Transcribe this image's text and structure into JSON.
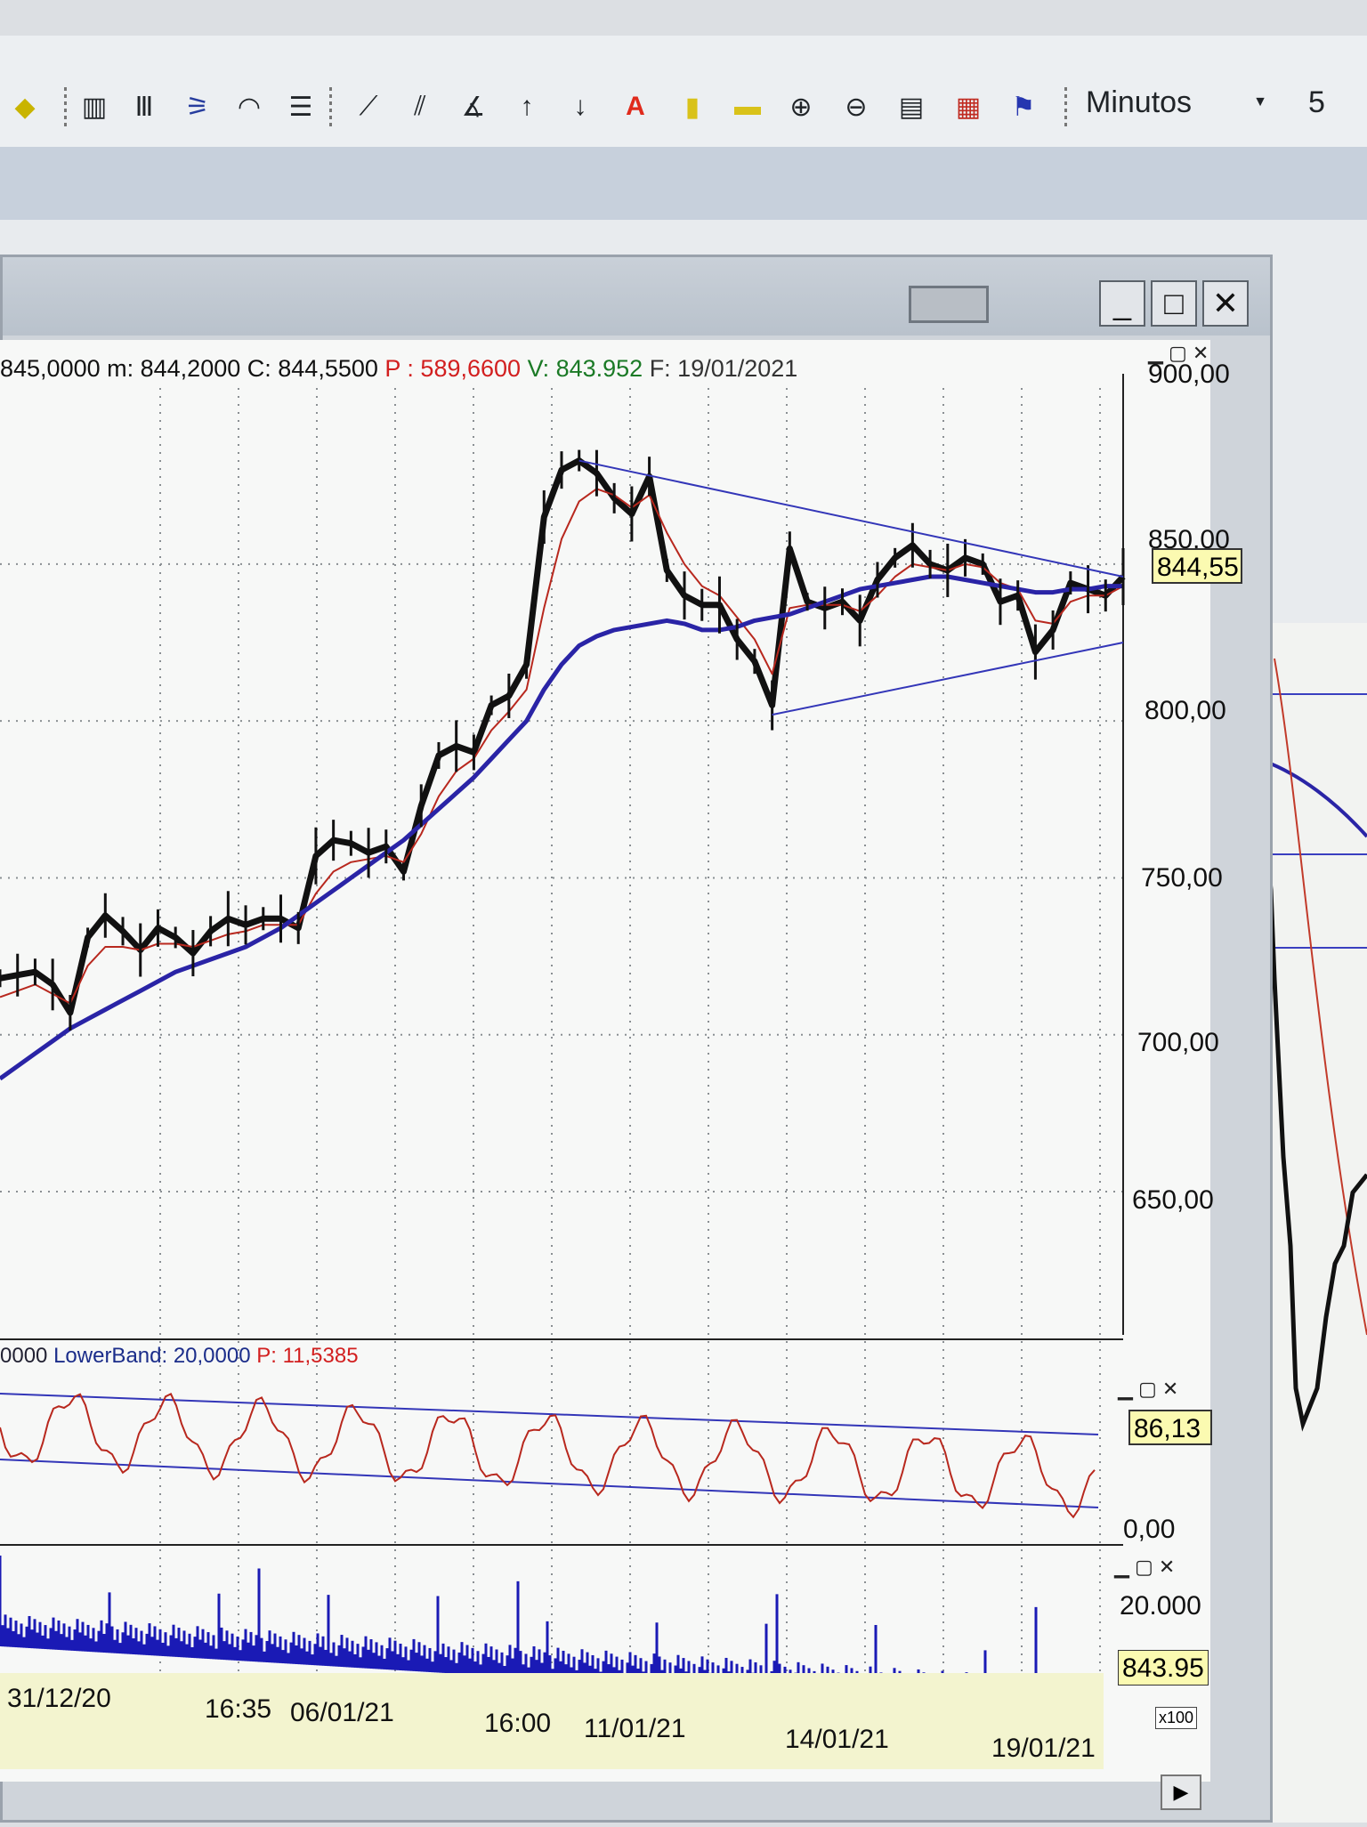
{
  "toolbar": {
    "interval_select": "Minutos",
    "interval_value": "5",
    "icons": [
      "diamond-icon",
      "vertical-line-icon",
      "vertical-lines-icon",
      "fan-icon",
      "arc-icon",
      "horizontal-lines-icon",
      "trendline-icon",
      "parallel-lines-icon",
      "angle-icon",
      "arrow-up-icon",
      "arrow-down-icon",
      "text-icon",
      "highlight-vertical-icon",
      "highlight-horizontal-icon",
      "zoom-in-icon",
      "zoom-out-icon",
      "properties-icon",
      "chart-settings-icon",
      "color-flag-icon"
    ]
  },
  "window": {
    "minimize_glyph": "_",
    "maximize_glyph": "□",
    "close_glyph": "✕"
  },
  "info": {
    "prefix": "845,0000",
    "min": "m: 844,2000",
    "close": "C: 844,5500",
    "p": "P : 589,6600",
    "volume": "V: 843.952",
    "date": "F: 19/01/2021"
  },
  "price_axis": {
    "labels": [
      "900,00",
      "850,00",
      "800,00",
      "750,00",
      "700,00",
      "650,00"
    ],
    "current_price": "844,55"
  },
  "oscillator": {
    "prefix": "0000",
    "lowerband": "LowerBand: 20,0000",
    "p": "P: 11,5385",
    "current": "86,13",
    "zero_label": "0,00"
  },
  "volume_pane": {
    "top_label": "20.000",
    "current": "843.95",
    "multiplier": "x100"
  },
  "dates": [
    "31/12/20",
    "16:35",
    "06/01/21",
    "16:00",
    "11/01/21",
    "14/01/21",
    "19/01/21"
  ],
  "chart_data": {
    "type": "line",
    "title": "",
    "ylabel": "",
    "xlabel": "",
    "ylim": [
      610,
      905
    ],
    "x": [
      0,
      1,
      2,
      3,
      4,
      5,
      6,
      7,
      8,
      9,
      10,
      11,
      12,
      13,
      14,
      15,
      16,
      17,
      18,
      19,
      20,
      21,
      22,
      23,
      24,
      25,
      26,
      27,
      28,
      29,
      30,
      31,
      32,
      33,
      34,
      35,
      36,
      37,
      38,
      39,
      40,
      41,
      42,
      43,
      44,
      45,
      46,
      47,
      48,
      49,
      50,
      51,
      52,
      53,
      54,
      55,
      56,
      57,
      58,
      59,
      60,
      61,
      62,
      63,
      64
    ],
    "series": [
      {
        "color": "#111111",
        "values": [
          718,
          719,
          720,
          716,
          707,
          731,
          738,
          733,
          727,
          734,
          731,
          726,
          733,
          737,
          735,
          737,
          737,
          734,
          757,
          762,
          761,
          758,
          760,
          752,
          773,
          789,
          792,
          790,
          805,
          808,
          818,
          865,
          880,
          883,
          879,
          871,
          866,
          878,
          848,
          840,
          837,
          837,
          826,
          819,
          805,
          855,
          838,
          836,
          838,
          832,
          845,
          852,
          856,
          850,
          848,
          852,
          850,
          838,
          840,
          822,
          829,
          844,
          842,
          840,
          846
        ]
      },
      {
        "color": "#b8281e",
        "values": [
          712,
          714,
          716,
          713,
          710,
          722,
          728,
          728,
          727,
          729,
          729,
          728,
          730,
          732,
          733,
          735,
          735,
          735,
          745,
          752,
          755,
          756,
          757,
          755,
          764,
          776,
          784,
          788,
          797,
          803,
          810,
          836,
          858,
          870,
          874,
          872,
          868,
          872,
          860,
          850,
          843,
          840,
          833,
          826,
          815,
          836,
          837,
          837,
          837,
          835,
          840,
          846,
          850,
          849,
          848,
          850,
          849,
          844,
          842,
          832,
          831,
          838,
          840,
          840,
          843
        ]
      },
      {
        "color": "#2a24a6",
        "values": [
          686,
          690,
          694,
          698,
          702,
          705,
          708,
          711,
          714,
          717,
          720,
          722,
          724,
          726,
          728,
          731,
          734,
          738,
          742,
          746,
          750,
          754,
          758,
          762,
          767,
          772,
          777,
          782,
          788,
          794,
          800,
          810,
          818,
          824,
          827,
          829,
          830,
          831,
          832,
          831,
          829,
          829,
          830,
          832,
          833,
          834,
          836,
          838,
          840,
          842,
          843,
          844,
          845,
          846,
          846,
          845,
          844,
          843,
          842,
          841,
          841,
          842,
          842,
          843,
          843
        ]
      }
    ],
    "trendlines": {
      "upper": [
        [
          33,
          883
        ],
        [
          64,
          846
        ]
      ],
      "lower": [
        [
          44,
          802
        ],
        [
          64,
          825
        ]
      ]
    }
  }
}
